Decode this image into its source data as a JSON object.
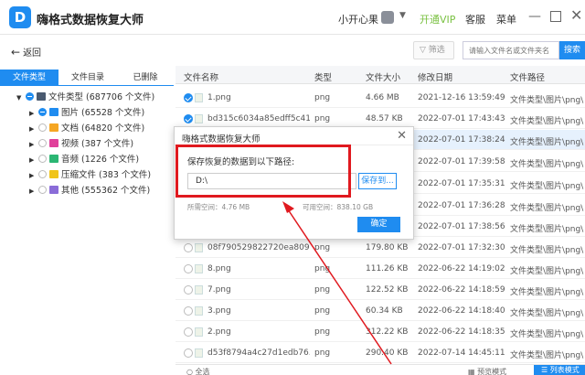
{
  "window": {
    "title": "嗨格式数据恢复大师",
    "logo_text": "D",
    "user": "小开心果",
    "vip": "开通VIP",
    "service": "客服",
    "menu": "菜单",
    "min": "—",
    "close": "✕"
  },
  "toolbar": {
    "back_label": "返回",
    "back_arrow": "←",
    "filter_label": "筛选",
    "search_placeholder": "请输入文件名或文件夹名",
    "search_button": "搜索"
  },
  "sidebar": {
    "tabs": [
      "文件类型",
      "文件目录",
      "已删除"
    ],
    "root": "文件类型 (687706 个文件)",
    "items": [
      {
        "label": "图片 (65528 个文件)",
        "color": "#1f8cf0",
        "checked": true
      },
      {
        "label": "文档 (64820 个文件)",
        "color": "#f5a623",
        "checked": false
      },
      {
        "label": "视频 (387 个文件)",
        "color": "#e0409a",
        "checked": false
      },
      {
        "label": "音频 (1226 个文件)",
        "color": "#2bb673",
        "checked": false
      },
      {
        "label": "压缩文件 (383 个文件)",
        "color": "#f0c419",
        "checked": false
      },
      {
        "label": "其他 (555362 个文件)",
        "color": "#8a6cd8",
        "checked": false
      }
    ]
  },
  "table": {
    "headers": [
      "文件名称",
      "类型",
      "文件大小",
      "修改日期",
      "文件路径"
    ],
    "rows": [
      {
        "name": "1.png",
        "type": "png",
        "size": "4.66 MB",
        "date": "2021-12-16 13:59:49",
        "path": "文件类型\\图片\\png\\",
        "checked": true
      },
      {
        "name": "bd315c6034a85edff5c41...",
        "type": "png",
        "size": "48.57 KB",
        "date": "2022-07-01 17:43:43",
        "path": "文件类型\\图片\\png\\",
        "checked": true
      },
      {
        "name": "",
        "type": "",
        "size": "",
        "date": "2022-07-01 17:38:24",
        "path": "文件类型\\图片\\png\\",
        "checked": false,
        "selected": true
      },
      {
        "name": "",
        "type": "",
        "size": "",
        "date": "2022-07-01 17:39:58",
        "path": "文件类型\\图片\\png\\",
        "checked": false
      },
      {
        "name": "",
        "type": "",
        "size": "",
        "date": "2022-07-01 17:35:31",
        "path": "文件类型\\图片\\png\\",
        "checked": false
      },
      {
        "name": "",
        "type": "",
        "size": "",
        "date": "2022-07-01 17:36:28",
        "path": "文件类型\\图片\\png\\",
        "checked": false
      },
      {
        "name": "",
        "type": "",
        "size": "",
        "date": "2022-07-01 17:38:56",
        "path": "文件类型\\图片\\png\\",
        "checked": false
      },
      {
        "name": "08f790529822720ea809...",
        "type": "png",
        "size": "179.80 KB",
        "date": "2022-07-01 17:32:30",
        "path": "文件类型\\图片\\png\\",
        "checked": false
      },
      {
        "name": "8.png",
        "type": "png",
        "size": "111.26 KB",
        "date": "2022-06-22 14:19:02",
        "path": "文件类型\\图片\\png\\",
        "checked": false
      },
      {
        "name": "7.png",
        "type": "png",
        "size": "122.52 KB",
        "date": "2022-06-22 14:18:59",
        "path": "文件类型\\图片\\png\\",
        "checked": false
      },
      {
        "name": "3.png",
        "type": "png",
        "size": "60.34 KB",
        "date": "2022-06-22 14:18:40",
        "path": "文件类型\\图片\\png\\",
        "checked": false
      },
      {
        "name": "2.png",
        "type": "png",
        "size": "312.22 KB",
        "date": "2022-06-22 14:18:35",
        "path": "文件类型\\图片\\png\\",
        "checked": false
      },
      {
        "name": "d53f8794a4c27d1edb76...",
        "type": "png",
        "size": "290.40 KB",
        "date": "2022-07-14 14:45:11",
        "path": "文件类型\\图片\\png\\",
        "checked": false
      }
    ]
  },
  "footer": {
    "select_all": "全选",
    "preview_mode": "预览模式",
    "list_mode": "列表模式"
  },
  "dialog": {
    "title": "嗨格式数据恢复大师",
    "label": "保存恢复的数据到以下路径:",
    "path_value": "D:\\",
    "browse": "保存到...",
    "required_space": "所需空间：4.76 MB",
    "available_space": "可用空间：838.10 GB",
    "ok": "确定",
    "close": "✕"
  },
  "colors": {
    "accent": "#1f8cf0",
    "highlight_box": "#e0191f",
    "vip": "#7ac142"
  }
}
